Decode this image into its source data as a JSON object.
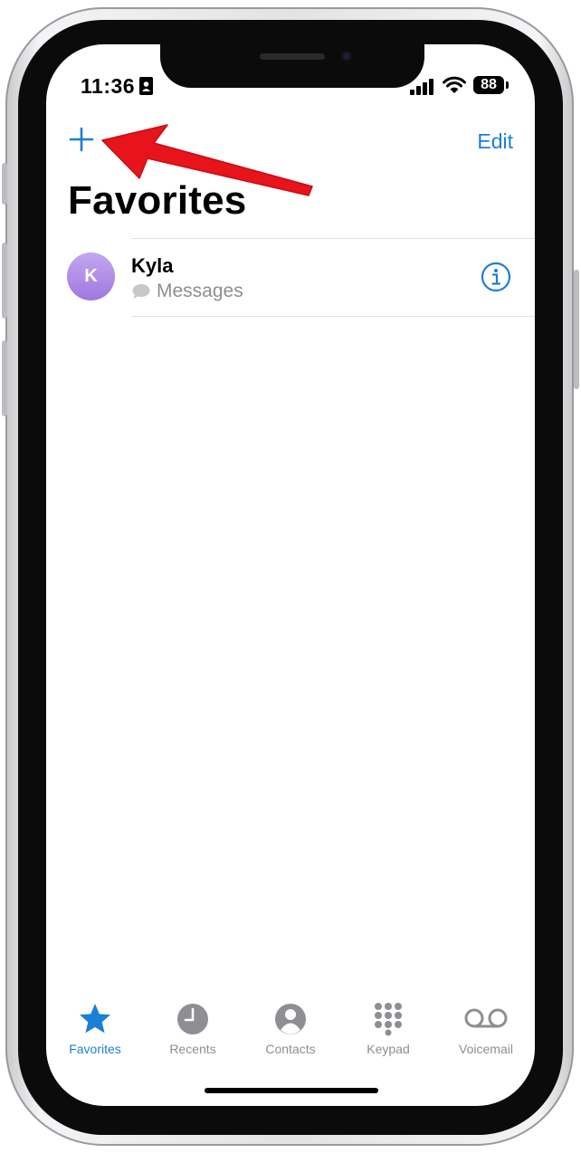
{
  "status_bar": {
    "time": "11:36",
    "battery": "88"
  },
  "nav": {
    "add_icon": "plus-icon",
    "edit_label": "Edit"
  },
  "page": {
    "title": "Favorites"
  },
  "favorites": [
    {
      "initial": "K",
      "name": "Kyla",
      "detail": "Messages",
      "detail_icon": "message-bubble-icon",
      "action_icon": "info-icon"
    }
  ],
  "tabs": [
    {
      "label": "Favorites",
      "icon": "star-icon",
      "active": true
    },
    {
      "label": "Recents",
      "icon": "clock-icon",
      "active": false
    },
    {
      "label": "Contacts",
      "icon": "person-icon",
      "active": false
    },
    {
      "label": "Keypad",
      "icon": "keypad-icon",
      "active": false
    },
    {
      "label": "Voicemail",
      "icon": "voicemail-icon",
      "active": false
    }
  ],
  "colors": {
    "accent": "#1b7fd6",
    "annotation_arrow": "#e8141b",
    "avatar": "#a887e4",
    "inactive": "#8e8e93"
  }
}
